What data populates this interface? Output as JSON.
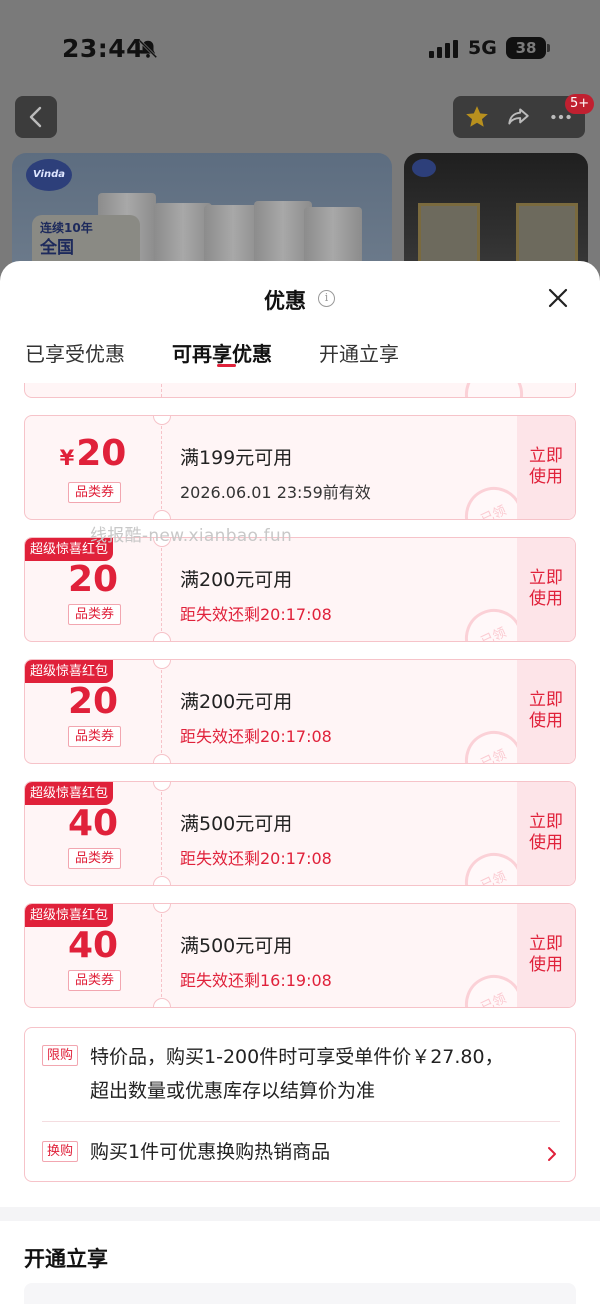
{
  "status_bar": {
    "time": "23:44",
    "network": "5G",
    "battery": "38"
  },
  "background": {
    "badge_count": "5+",
    "banner_logo": "Vinda",
    "banner_tag_line1": "连续10年",
    "banner_tag_line2": "全国"
  },
  "sheet": {
    "title": "优惠",
    "tabs": [
      {
        "label": "已享受优惠"
      },
      {
        "label": "可再享优惠"
      },
      {
        "label": "开通立享"
      }
    ],
    "active_tab": 1
  },
  "coupons": [
    {
      "currency": "¥",
      "amount": "20",
      "category": "品类券",
      "condition": "满199元可用",
      "validity": "2026.06.01 23:59前有效",
      "use_label": "立即使用",
      "stamp": "已领"
    },
    {
      "ribbon": "超级惊喜红包",
      "amount": "20",
      "category": "品类券",
      "condition": "满200元可用",
      "validity": "距失效还剩20:17:08",
      "use_label": "立即使用",
      "stamp": "已领"
    },
    {
      "ribbon": "超级惊喜红包",
      "amount": "20",
      "category": "品类券",
      "condition": "满200元可用",
      "validity": "距失效还剩20:17:08",
      "use_label": "立即使用",
      "stamp": "已领"
    },
    {
      "ribbon": "超级惊喜红包",
      "amount": "40",
      "category": "品类券",
      "condition": "满500元可用",
      "validity": "距失效还剩20:17:08",
      "use_label": "立即使用",
      "stamp": "已领"
    },
    {
      "ribbon": "超级惊喜红包",
      "amount": "40",
      "category": "品类券",
      "condition": "满500元可用",
      "validity": "距失效还剩16:19:08",
      "use_label": "立即使用",
      "stamp": "已领"
    }
  ],
  "watermark": "线报酷-new.xianbao.fun",
  "promos": {
    "limit_tag": "限购",
    "limit_line1": "特价品，购买1-200件时可享受单件价￥27.80，",
    "limit_line2": "超出数量或优惠库存以结算价为准",
    "swap_tag": "换购",
    "swap_text": "购买1件可优惠换购热销商品"
  },
  "section": {
    "title": "开通立享"
  },
  "colors": {
    "accent": "#e0213a",
    "coupon_bg": "#fff5f6",
    "coupon_border": "#f6c3c9"
  }
}
